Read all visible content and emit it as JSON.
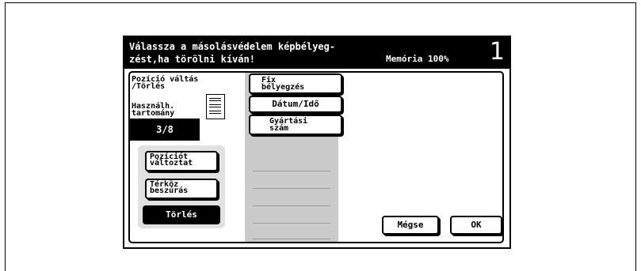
{
  "header": {
    "message": "Válassza a másolásvédelem képbélyeg-\nzést,ha törölni kíván!",
    "memory": "Memória 100%",
    "number": "1"
  },
  "left": {
    "title": "Pozíció váltás\n/Törlés",
    "range_label": "Használh.\ntartomány",
    "counter": "3/8",
    "buttons": {
      "move": "Pozíciót\nváltoztat",
      "insert": "Térköz\nbeszúrás",
      "delete": "Törlés"
    }
  },
  "options": {
    "fixed_stamp": "Fix\nbélyegzés",
    "date_time": "Dátum/Idő",
    "serial_number": "Gyártási\nszám"
  },
  "footer": {
    "cancel": "Mégse",
    "ok": "OK"
  },
  "colors": {
    "primary": "#000000",
    "background": "#ffffff",
    "hatch": "#8a8a8a"
  },
  "icons": {
    "page": "page-layout-icon"
  }
}
